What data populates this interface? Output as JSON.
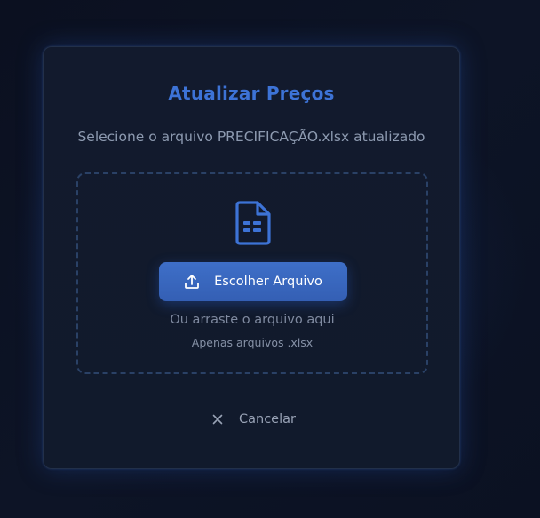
{
  "modal": {
    "title": "Atualizar Preços",
    "subtitle": "Selecione o arquivo PRECIFICAÇÃO.xlsx atualizado",
    "dropzone": {
      "icon": "file-icon",
      "button_label": "Escolher Arquivo",
      "button_icon": "upload-icon",
      "drag_text": "Ou arraste o arquivo aqui",
      "hint": "Apenas arquivos .xlsx"
    },
    "cancel_label": "Cancelar",
    "cancel_icon": "close-icon"
  },
  "colors": {
    "accent": "#3d73d6",
    "button": "#3a68c0",
    "background": "#0c1222",
    "panel": "#121a2d"
  }
}
